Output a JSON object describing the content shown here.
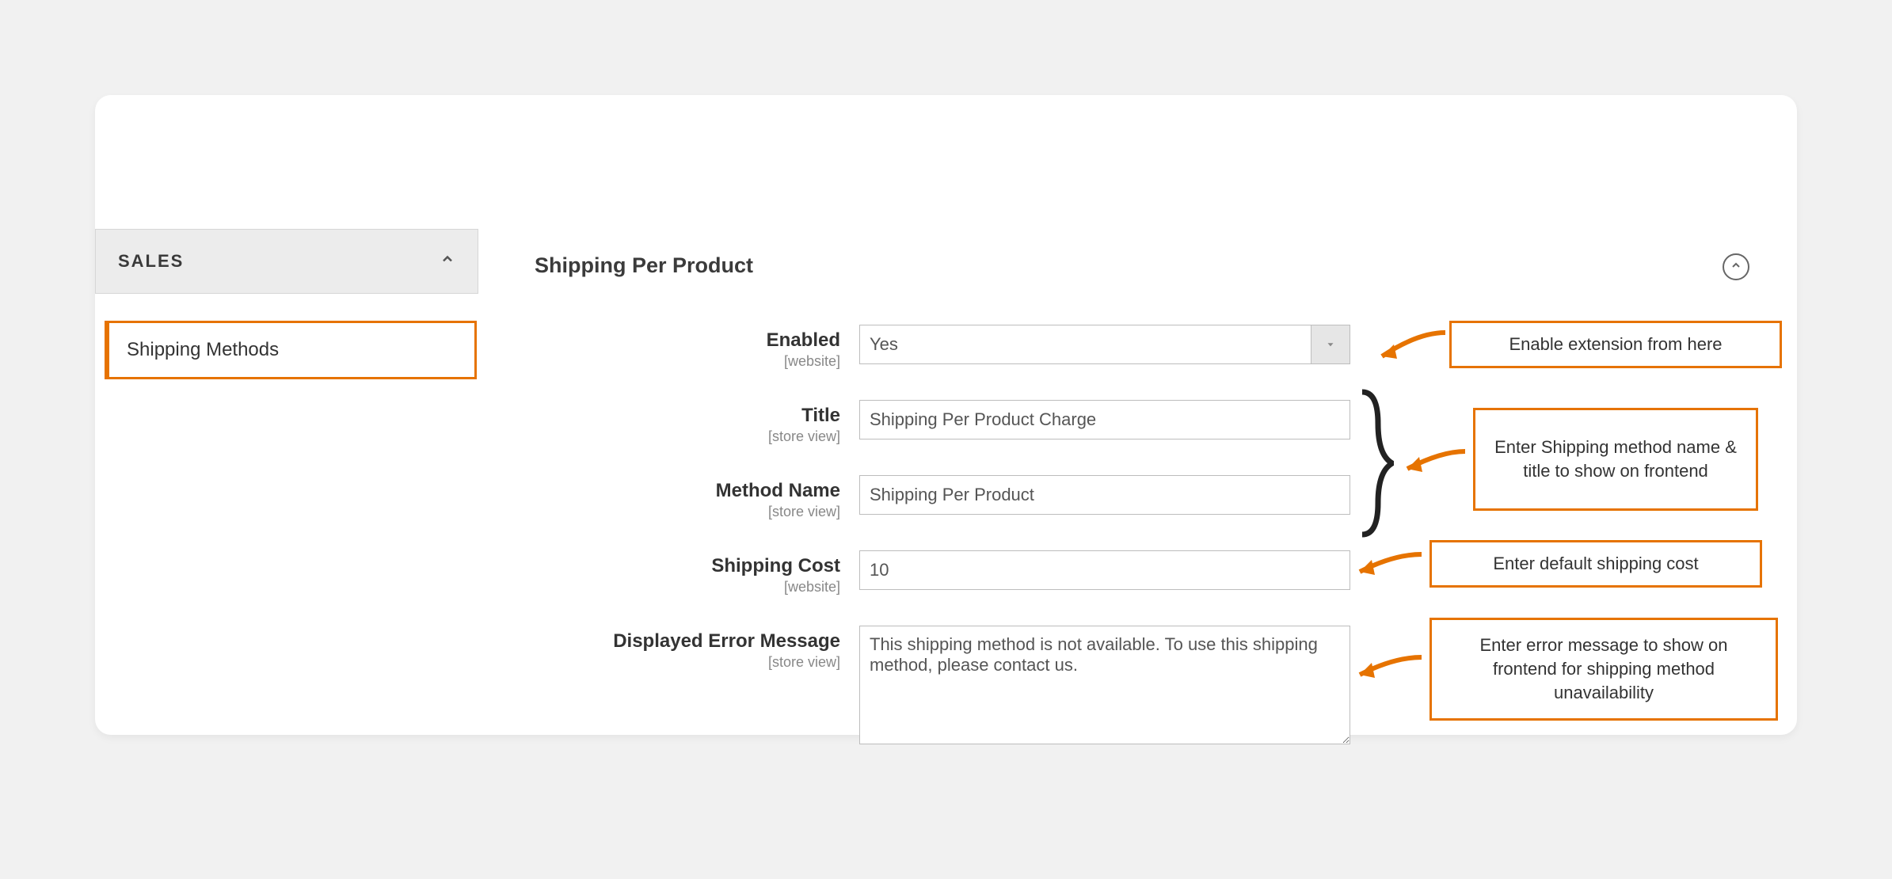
{
  "sidebar": {
    "header": "SALES",
    "item": "Shipping Methods"
  },
  "section": {
    "title": "Shipping Per Product"
  },
  "fields": {
    "enabled": {
      "label": "Enabled",
      "scope": "[website]",
      "value": "Yes"
    },
    "title": {
      "label": "Title",
      "scope": "[store view]",
      "value": "Shipping Per Product Charge"
    },
    "method": {
      "label": "Method Name",
      "scope": "[store view]",
      "value": "Shipping Per Product"
    },
    "cost": {
      "label": "Shipping Cost",
      "scope": "[website]",
      "value": "10"
    },
    "error": {
      "label": "Displayed Error Message",
      "scope": "[store view]",
      "value": "This shipping method is not available. To use this shipping method, please contact us."
    }
  },
  "annotations": {
    "a1": "Enable extension from here",
    "a2": "Enter Shipping method name & title to show on frontend",
    "a3": "Enter default shipping cost",
    "a4": "Enter error message to show on frontend for shipping method unavailability"
  }
}
